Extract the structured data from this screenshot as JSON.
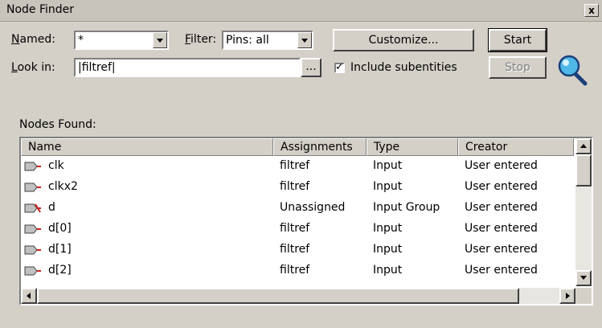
{
  "window": {
    "title": "Node Finder",
    "close_glyph": "x"
  },
  "named": {
    "label": "Named:",
    "value": "*"
  },
  "filter": {
    "label": "Filter:",
    "value": "Pins: all"
  },
  "buttons": {
    "customize": "Customize...",
    "start": "Start",
    "stop": "Stop",
    "browse": "..."
  },
  "look_in": {
    "label": "Look in:",
    "value": "|filtref|"
  },
  "include_subentities": {
    "label": "Include subentities",
    "checked": true
  },
  "nodes_found": {
    "label": "Nodes Found:"
  },
  "table": {
    "columns": [
      "Name",
      "Assignments",
      "Type",
      "Creator"
    ],
    "rows": [
      {
        "name": "clk",
        "assignments": "filtref",
        "type": "Input",
        "creator": "User entered",
        "icon": "input-pin-icon"
      },
      {
        "name": "clkx2",
        "assignments": "filtref",
        "type": "Input",
        "creator": "User entered",
        "icon": "input-pin-icon"
      },
      {
        "name": "d",
        "assignments": "Unassigned",
        "type": "Input Group",
        "creator": "User entered",
        "icon": "input-group-pin-icon"
      },
      {
        "name": "d[0]",
        "assignments": "filtref",
        "type": "Input",
        "creator": "User entered",
        "icon": "input-pin-icon"
      },
      {
        "name": "d[1]",
        "assignments": "filtref",
        "type": "Input",
        "creator": "User entered",
        "icon": "input-pin-icon"
      },
      {
        "name": "d[2]",
        "assignments": "filtref",
        "type": "Input",
        "creator": "User entered",
        "icon": "input-pin-icon"
      }
    ]
  },
  "colors": {
    "window_bg": "#d4d0c8",
    "magnifier_blue": "#4fb8e8",
    "pin_red": "#d02020"
  },
  "icons": {
    "magnifier": "magnifier-icon",
    "input_pin": "input-pin-icon",
    "input_group": "input-group-pin-icon"
  }
}
